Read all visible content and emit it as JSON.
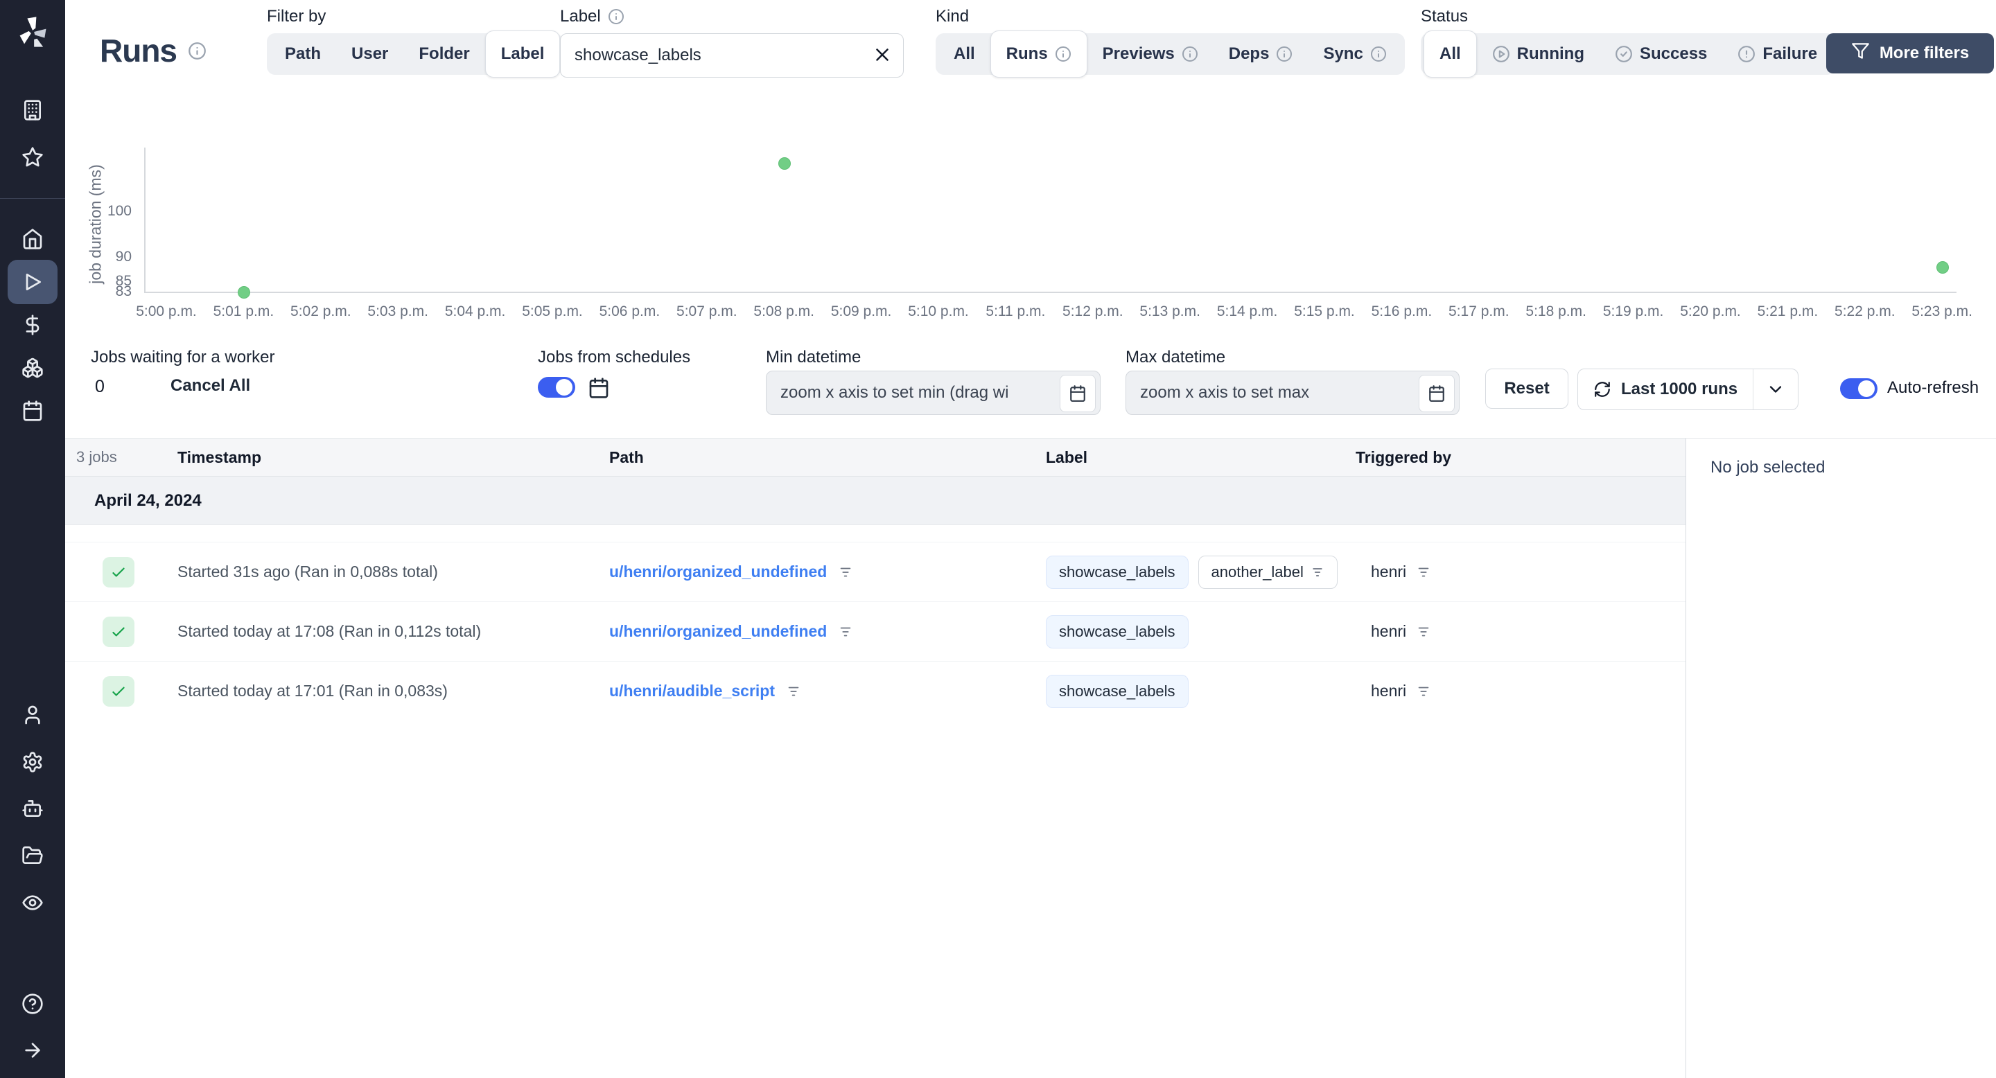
{
  "colors": {
    "sidebar_bg": "#1e2230",
    "accent_blue": "#3b5ef0",
    "link_blue": "#3f7ff2",
    "success_green": "#16a34a",
    "dot_green": "#71ce85",
    "dark_button": "#3e4c66"
  },
  "sidebar": {
    "logo_icon": "windmill-logo",
    "icons": [
      "building",
      "star",
      "home",
      "play",
      "dollar",
      "boxes",
      "calendar",
      "user",
      "gear",
      "robot",
      "folder-open",
      "eye",
      "help-circle",
      "arrow-right"
    ],
    "selected_icon": "play"
  },
  "header": {
    "title": "Runs",
    "filter_by": {
      "label": "Filter by",
      "options": [
        "Path",
        "User",
        "Folder",
        "Label"
      ],
      "selected": "Label"
    },
    "label_filter": {
      "label": "Label",
      "value": "showcase_labels"
    },
    "kind": {
      "label": "Kind",
      "options": [
        "All",
        "Runs",
        "Previews",
        "Deps",
        "Sync"
      ],
      "selected": "Runs"
    },
    "status": {
      "label": "Status",
      "options": [
        "All",
        "Running",
        "Success",
        "Failure"
      ],
      "selected": "All"
    },
    "more_filters_label": "More filters"
  },
  "chart_data": {
    "type": "scatter",
    "title": "",
    "xlabel": "",
    "ylabel": "job duration (ms)",
    "yscale": "log",
    "grid": false,
    "yticks": [
      100,
      90,
      85,
      83
    ],
    "x_labels": [
      "5:00 p.m.",
      "5:01 p.m.",
      "5:02 p.m.",
      "5:03 p.m.",
      "5:04 p.m.",
      "5:05 p.m.",
      "5:06 p.m.",
      "5:07 p.m.",
      "5:08 p.m.",
      "5:09 p.m.",
      "5:10 p.m.",
      "5:11 p.m.",
      "5:12 p.m.",
      "5:13 p.m.",
      "5:14 p.m.",
      "5:15 p.m.",
      "5:16 p.m.",
      "5:17 p.m.",
      "5:18 p.m.",
      "5:19 p.m.",
      "5:20 p.m.",
      "5:21 p.m.",
      "5:22 p.m.",
      "5:23 p.m."
    ],
    "points": [
      {
        "time": "5:01 p.m.",
        "duration_ms": 83
      },
      {
        "time": "5:08 p.m.",
        "duration_ms": 112
      },
      {
        "time": "5:23 p.m.",
        "duration_ms": 88
      }
    ],
    "point_color": "#71ce85"
  },
  "controls": {
    "jobs_waiting": {
      "label": "Jobs waiting for a worker",
      "count": "0",
      "cancel_all": "Cancel All"
    },
    "jobs_from_schedules": {
      "label": "Jobs from schedules",
      "enabled": true
    },
    "min_datetime": {
      "label": "Min datetime",
      "value": "zoom x axis to set min (drag wi"
    },
    "max_datetime": {
      "label": "Max datetime",
      "value": "zoom x axis to set max"
    },
    "reset_label": "Reset",
    "runs_window": {
      "label": "Last 1000 runs"
    },
    "auto_refresh": {
      "label": "Auto-refresh",
      "enabled": true
    }
  },
  "table": {
    "count_label": "3 jobs",
    "columns": [
      "Timestamp",
      "Path",
      "Label",
      "Triggered by"
    ],
    "date_group": "April 24, 2024",
    "rows": [
      {
        "status": "success",
        "timestamp": "Started 31s ago (Ran in 0,088s total)",
        "path": "u/henri/organized_undefined",
        "labels": [
          "showcase_labels",
          "another_label"
        ],
        "triggered_by": "henri"
      },
      {
        "status": "success",
        "timestamp": "Started today at 17:08 (Ran in 0,112s total)",
        "path": "u/henri/organized_undefined",
        "labels": [
          "showcase_labels"
        ],
        "triggered_by": "henri"
      },
      {
        "status": "success",
        "timestamp": "Started today at 17:01 (Ran in 0,083s)",
        "path": "u/henri/audible_script",
        "labels": [
          "showcase_labels"
        ],
        "triggered_by": "henri"
      }
    ]
  },
  "detail_panel": {
    "empty_text": "No job selected"
  }
}
